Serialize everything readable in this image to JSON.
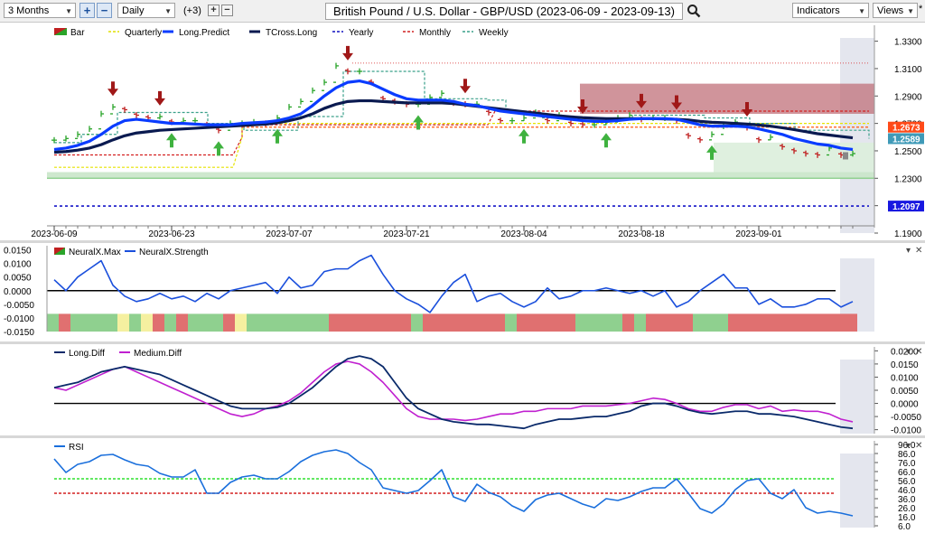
{
  "toolbar": {
    "period": "3 Months",
    "interval": "Daily",
    "offset": "(+3)",
    "plus_icon": "plus-icon",
    "minus_icon": "minus-icon",
    "title": "British Pound / U.S. Dollar - GBP/USD (2023-06-09 - 2023-09-13)",
    "search_icon": "search-icon",
    "indicators": "Indicators",
    "views": "Views",
    "pin": "*"
  },
  "price_panel": {
    "legend": [
      {
        "label": "Bar",
        "color": "#2a9a2a"
      },
      {
        "label": "Quarterly",
        "color": "#e0e000"
      },
      {
        "label": "Long.Predict",
        "color": "#0a3cff"
      },
      {
        "label": "TCross.Long",
        "color": "#0a1a50"
      },
      {
        "label": "Yearly",
        "color": "#1010c0"
      },
      {
        "label": "Monthly",
        "color": "#d02020"
      },
      {
        "label": "Weekly",
        "color": "#3aa08a"
      }
    ],
    "y_ticks": [
      "1.3300",
      "1.3100",
      "1.2900",
      "1.2700",
      "1.2500",
      "1.2300",
      "1.2100",
      "1.1900"
    ],
    "x_ticks": [
      "2023-06-09",
      "2023-06-23",
      "2023-07-07",
      "2023-07-21",
      "2023-08-04",
      "2023-08-18",
      "2023-09-01"
    ],
    "badges": [
      {
        "value": "1.2673",
        "color": "#ff4a18"
      },
      {
        "value": "1.2589",
        "color": "#3f9ab8"
      },
      {
        "value": "1.2097",
        "color": "#1818e0"
      }
    ]
  },
  "neural_panel": {
    "legend": [
      {
        "label": "NeuralX.Max",
        "color": "#d03030"
      },
      {
        "label": "NeuralX.Strength",
        "color": "#1a4fdc"
      }
    ],
    "y_ticks": [
      "0.0150",
      "0.0100",
      "0.0050",
      "0.0000",
      "-0.0050",
      "-0.0100",
      "-0.0150"
    ]
  },
  "diff_panel": {
    "legend": [
      {
        "label": "Long.Diff",
        "color": "#0a2a6a"
      },
      {
        "label": "Medium.Diff",
        "color": "#c020d0"
      }
    ],
    "y_ticks": [
      "0.0200",
      "0.0150",
      "0.0100",
      "0.0050",
      "0.0000",
      "-0.0050",
      "-0.0100"
    ]
  },
  "rsi_panel": {
    "legend": [
      {
        "label": "RSI",
        "color": "#1a6fdc"
      }
    ],
    "y_ticks": [
      "96.0",
      "86.0",
      "76.0",
      "66.0",
      "56.0",
      "46.0",
      "36.0",
      "26.0",
      "16.0",
      "6.0"
    ]
  },
  "chart_data": [
    {
      "type": "line",
      "title": "British Pound / U.S. Dollar - GBP/USD (2023-06-09 - 2023-09-13)",
      "x": [
        "2023-06-09",
        "2023-06-12",
        "2023-06-13",
        "2023-06-14",
        "2023-06-15",
        "2023-06-16",
        "2023-06-19",
        "2023-06-20",
        "2023-06-21",
        "2023-06-22",
        "2023-06-23",
        "2023-06-26",
        "2023-06-27",
        "2023-06-28",
        "2023-06-29",
        "2023-06-30",
        "2023-07-03",
        "2023-07-04",
        "2023-07-05",
        "2023-07-06",
        "2023-07-07",
        "2023-07-10",
        "2023-07-11",
        "2023-07-12",
        "2023-07-13",
        "2023-07-14",
        "2023-07-17",
        "2023-07-18",
        "2023-07-19",
        "2023-07-20",
        "2023-07-21",
        "2023-07-24",
        "2023-07-25",
        "2023-07-26",
        "2023-07-27",
        "2023-07-28",
        "2023-07-31",
        "2023-08-01",
        "2023-08-02",
        "2023-08-03",
        "2023-08-04",
        "2023-08-07",
        "2023-08-08",
        "2023-08-09",
        "2023-08-10",
        "2023-08-11",
        "2023-08-14",
        "2023-08-15",
        "2023-08-16",
        "2023-08-17",
        "2023-08-18",
        "2023-08-21",
        "2023-08-22",
        "2023-08-23",
        "2023-08-24",
        "2023-08-25",
        "2023-08-28",
        "2023-08-29",
        "2023-08-30",
        "2023-08-31",
        "2023-09-01",
        "2023-09-04",
        "2023-09-05",
        "2023-09-06",
        "2023-09-07",
        "2023-09-08",
        "2023-09-11",
        "2023-09-12",
        "2023-09-13"
      ],
      "series": [
        {
          "name": "Bar",
          "values": [
            1.2578,
            1.259,
            1.262,
            1.266,
            1.277,
            1.282,
            1.28,
            1.276,
            1.274,
            1.275,
            1.271,
            1.272,
            1.272,
            1.269,
            1.265,
            1.27,
            1.27,
            1.271,
            1.27,
            1.274,
            1.282,
            1.286,
            1.294,
            1.3,
            1.312,
            1.308,
            1.308,
            1.3,
            1.288,
            1.286,
            1.284,
            1.284,
            1.289,
            1.292,
            1.285,
            1.284,
            1.284,
            1.278,
            1.272,
            1.272,
            1.274,
            1.278,
            1.272,
            1.276,
            1.27,
            1.269,
            1.269,
            1.271,
            1.274,
            1.276,
            1.273,
            1.274,
            1.274,
            1.272,
            1.261,
            1.258,
            1.262,
            1.268,
            1.271,
            1.267,
            1.258,
            1.26,
            1.253,
            1.25,
            1.248,
            1.247,
            1.252,
            1.247,
            1.248
          ]
        },
        {
          "name": "Long.Predict",
          "values": [
            1.251,
            1.252,
            1.254,
            1.257,
            1.262,
            1.268,
            1.272,
            1.273,
            1.272,
            1.271,
            1.27,
            1.27,
            1.2695,
            1.269,
            1.269,
            1.269,
            1.27,
            1.2705,
            1.271,
            1.272,
            1.274,
            1.277,
            1.283,
            1.29,
            1.296,
            1.3,
            1.301,
            1.299,
            1.295,
            1.291,
            1.288,
            1.287,
            1.287,
            1.287,
            1.286,
            1.284,
            1.283,
            1.281,
            1.279,
            1.278,
            1.277,
            1.276,
            1.275,
            1.274,
            1.273,
            1.272,
            1.2715,
            1.2715,
            1.272,
            1.273,
            1.2735,
            1.2735,
            1.2735,
            1.273,
            1.271,
            1.269,
            1.268,
            1.268,
            1.268,
            1.2675,
            1.266,
            1.264,
            1.262,
            1.259,
            1.257,
            1.255,
            1.254,
            1.252,
            1.251
          ]
        },
        {
          "name": "TCross.Long",
          "values": [
            1.249,
            1.2495,
            1.2505,
            1.252,
            1.2545,
            1.258,
            1.261,
            1.263,
            1.264,
            1.265,
            1.2655,
            1.266,
            1.2665,
            1.267,
            1.2675,
            1.268,
            1.2685,
            1.269,
            1.2695,
            1.2705,
            1.272,
            1.274,
            1.277,
            1.281,
            1.284,
            1.286,
            1.2865,
            1.2865,
            1.286,
            1.2855,
            1.285,
            1.285,
            1.285,
            1.285,
            1.2845,
            1.2835,
            1.2825,
            1.2815,
            1.2805,
            1.2795,
            1.2785,
            1.2775,
            1.2765,
            1.2755,
            1.2748,
            1.2742,
            1.2738,
            1.2735,
            1.2735,
            1.2735,
            1.2735,
            1.2735,
            1.2733,
            1.273,
            1.2725,
            1.2715,
            1.2708,
            1.2705,
            1.27,
            1.2695,
            1.2688,
            1.268,
            1.2668,
            1.2655,
            1.264,
            1.2625,
            1.2615,
            1.2605,
            1.2595
          ]
        }
      ],
      "levels": {
        "Yearly": 1.2097,
        "Monthly": 1.2673,
        "Weekly": 1.2589
      },
      "ylim": [
        1.19,
        1.335
      ],
      "grid": false,
      "legend": "top-left"
    },
    {
      "type": "line",
      "x_ref": "same as price panel",
      "series": [
        {
          "name": "NeuralX.Strength",
          "values": [
            0.004,
            0.0,
            0.005,
            0.008,
            0.011,
            0.002,
            -0.002,
            -0.004,
            -0.003,
            -0.001,
            -0.003,
            -0.002,
            -0.004,
            -0.001,
            -0.003,
            0.0,
            0.001,
            0.002,
            0.003,
            -0.001,
            0.005,
            0.001,
            0.002,
            0.007,
            0.008,
            0.008,
            0.011,
            0.013,
            0.006,
            0.0,
            -0.003,
            -0.005,
            -0.008,
            -0.002,
            0.003,
            0.006,
            -0.004,
            -0.002,
            -0.001,
            -0.004,
            -0.006,
            -0.004,
            0.001,
            -0.003,
            -0.002,
            0.0,
            0.0,
            0.001,
            0.0,
            -0.001,
            0.0,
            -0.002,
            0.0,
            -0.006,
            -0.004,
            0.0,
            0.003,
            0.006,
            0.001,
            0.001,
            -0.005,
            -0.003,
            -0.006,
            -0.006,
            -0.005,
            -0.003,
            -0.003,
            -0.006,
            -0.004
          ]
        },
        {
          "name": "NeuralX.Max",
          "values": [
            "green",
            "red",
            "green",
            "green",
            "green",
            "green",
            "yellow",
            "green",
            "yellow",
            "red",
            "green",
            "red",
            "green",
            "green",
            "green",
            "red",
            "yellow",
            "green",
            "green",
            "green",
            "green",
            "green",
            "green",
            "green",
            "red",
            "red",
            "red",
            "red",
            "red",
            "red",
            "red",
            "green",
            "red",
            "red",
            "red",
            "red",
            "red",
            "red",
            "red",
            "green",
            "red",
            "red",
            "red",
            "red",
            "red",
            "green",
            "green",
            "green",
            "green",
            "red",
            "green",
            "red",
            "red",
            "red",
            "red",
            "green",
            "green",
            "green",
            "red",
            "red",
            "red",
            "red",
            "red",
            "red",
            "red",
            "red",
            "red",
            "red",
            "red"
          ]
        }
      ],
      "ylim": [
        -0.015,
        0.0165
      ],
      "legend": "top-left"
    },
    {
      "type": "line",
      "x_ref": "same as price panel",
      "series": [
        {
          "name": "Long.Diff",
          "values": [
            0.006,
            0.007,
            0.008,
            0.01,
            0.012,
            0.013,
            0.014,
            0.013,
            0.012,
            0.011,
            0.009,
            0.007,
            0.005,
            0.003,
            0.001,
            -0.001,
            -0.002,
            -0.002,
            -0.002,
            -0.0015,
            0.0,
            0.003,
            0.006,
            0.01,
            0.014,
            0.017,
            0.018,
            0.017,
            0.014,
            0.008,
            0.002,
            -0.002,
            -0.004,
            -0.006,
            -0.007,
            -0.0075,
            -0.008,
            -0.008,
            -0.0085,
            -0.009,
            -0.0095,
            -0.008,
            -0.007,
            -0.006,
            -0.006,
            -0.0055,
            -0.005,
            -0.005,
            -0.004,
            -0.003,
            -0.001,
            0.0,
            0.0,
            -0.001,
            -0.0025,
            -0.0035,
            -0.004,
            -0.0035,
            -0.003,
            -0.003,
            -0.004,
            -0.004,
            -0.0045,
            -0.005,
            -0.006,
            -0.007,
            -0.008,
            -0.009,
            -0.0095
          ]
        },
        {
          "name": "Medium.Diff",
          "values": [
            0.006,
            0.005,
            0.007,
            0.009,
            0.011,
            0.013,
            0.014,
            0.012,
            0.01,
            0.008,
            0.006,
            0.004,
            0.002,
            0.0,
            -0.002,
            -0.004,
            -0.005,
            -0.004,
            -0.002,
            -0.001,
            0.001,
            0.004,
            0.008,
            0.012,
            0.015,
            0.016,
            0.015,
            0.012,
            0.008,
            0.003,
            -0.002,
            -0.005,
            -0.006,
            -0.006,
            -0.006,
            -0.0065,
            -0.006,
            -0.005,
            -0.004,
            -0.004,
            -0.003,
            -0.003,
            -0.002,
            -0.002,
            -0.002,
            -0.001,
            -0.001,
            -0.001,
            -0.0005,
            0.0,
            0.001,
            0.002,
            0.0015,
            0.0,
            -0.002,
            -0.003,
            -0.003,
            -0.0015,
            -0.0005,
            -0.0005,
            -0.002,
            -0.001,
            -0.003,
            -0.0025,
            -0.003,
            -0.003,
            -0.004,
            -0.006,
            -0.007
          ]
        }
      ],
      "ylim": [
        -0.0115,
        0.0215
      ],
      "legend": "top-left"
    },
    {
      "type": "line",
      "x_ref": "same as price panel",
      "series": [
        {
          "name": "RSI",
          "values": [
            80,
            65,
            74,
            77,
            84,
            85,
            79,
            74,
            72,
            64,
            60,
            60,
            68,
            42,
            42,
            54,
            60,
            62,
            58,
            58,
            66,
            77,
            84,
            88,
            90,
            86,
            76,
            68,
            48,
            45,
            42,
            45,
            56,
            68,
            38,
            33,
            52,
            43,
            38,
            28,
            22,
            35,
            40,
            42,
            36,
            30,
            26,
            36,
            34,
            38,
            44,
            48,
            48,
            58,
            42,
            25,
            20,
            30,
            46,
            56,
            58,
            42,
            36,
            46,
            26,
            20,
            22,
            20,
            17
          ]
        }
      ],
      "ylim": [
        4,
        100
      ],
      "levels": {
        "overbought": 58,
        "oversold": 42
      },
      "legend": "top-left"
    }
  ]
}
